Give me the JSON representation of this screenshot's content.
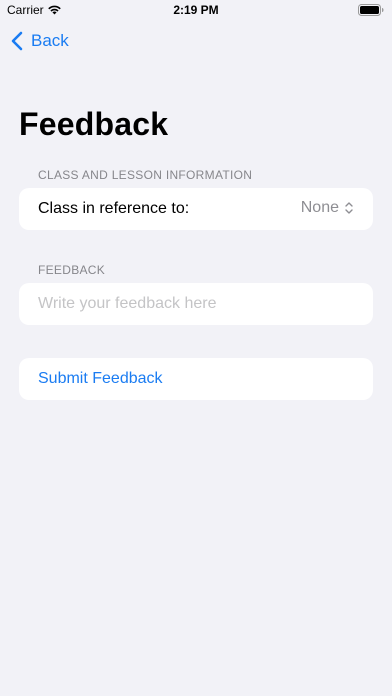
{
  "status_bar": {
    "carrier": "Carrier",
    "time": "2:19 PM"
  },
  "nav": {
    "back_label": "Back"
  },
  "page": {
    "title": "Feedback"
  },
  "class_section": {
    "header": "CLASS AND LESSON INFORMATION",
    "row_label": "Class in reference to:",
    "picker_value": "None"
  },
  "feedback_section": {
    "header": "FEEDBACK",
    "placeholder": "Write your feedback here",
    "value": ""
  },
  "submit": {
    "label": "Submit Feedback"
  },
  "colors": {
    "accent": "#1a7cf2",
    "background": "#f2f2f7",
    "card": "#ffffff",
    "secondary_text": "#86868b",
    "placeholder": "#c4c4c6"
  },
  "icons": {
    "wifi": "wifi-icon",
    "battery": "battery-icon",
    "back": "chevron-left-icon",
    "picker": "chevron-up-down-icon"
  }
}
